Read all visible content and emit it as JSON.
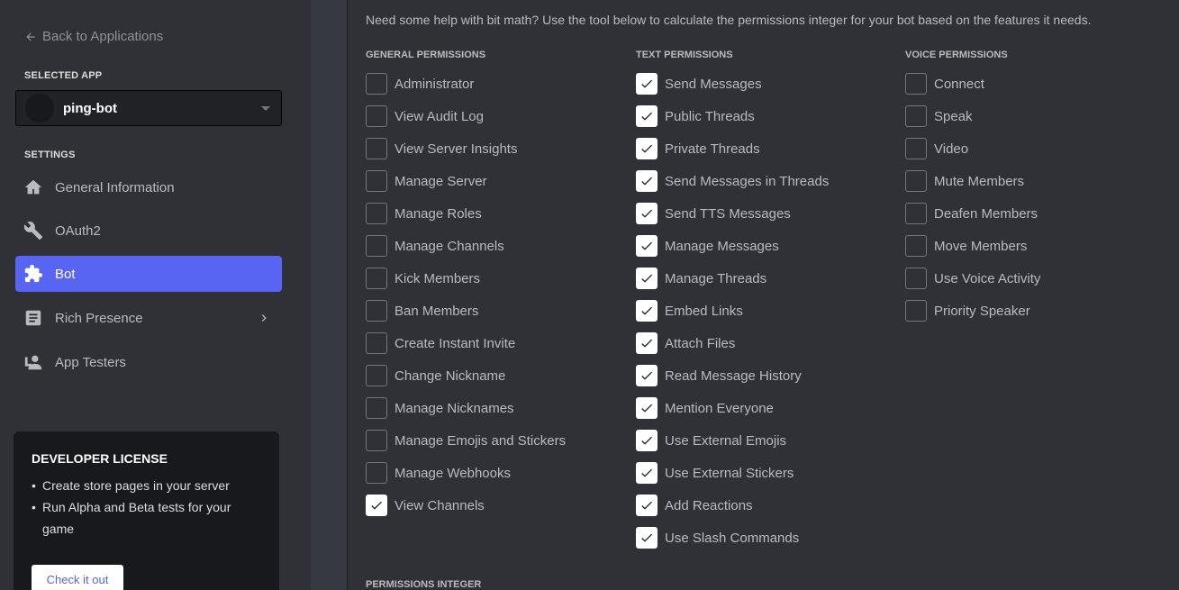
{
  "sidebar": {
    "back_label": "Back to Applications",
    "selected_app_label": "SELECTED APP",
    "app_name": "ping-bot",
    "settings_label": "SETTINGS",
    "nav": [
      {
        "label": "General Information",
        "icon": "home-icon"
      },
      {
        "label": "OAuth2",
        "icon": "wrench-icon"
      },
      {
        "label": "Bot",
        "icon": "puzzle-icon",
        "active": true
      },
      {
        "label": "Rich Presence",
        "icon": "document-icon",
        "has_chevron": true
      },
      {
        "label": "App Testers",
        "icon": "person-icon"
      }
    ],
    "license": {
      "title": "DEVELOPER LICENSE",
      "items": [
        "Create store pages in your server",
        "Run Alpha and Beta tests for your game"
      ],
      "button": "Check it out"
    }
  },
  "main": {
    "help_text": "Need some help with bit math? Use the tool below to calculate the permissions integer for your bot based on the features it needs.",
    "columns": [
      {
        "heading": "GENERAL PERMISSIONS",
        "items": [
          {
            "label": "Administrator",
            "checked": false
          },
          {
            "label": "View Audit Log",
            "checked": false
          },
          {
            "label": "View Server Insights",
            "checked": false
          },
          {
            "label": "Manage Server",
            "checked": false
          },
          {
            "label": "Manage Roles",
            "checked": false
          },
          {
            "label": "Manage Channels",
            "checked": false
          },
          {
            "label": "Kick Members",
            "checked": false
          },
          {
            "label": "Ban Members",
            "checked": false
          },
          {
            "label": "Create Instant Invite",
            "checked": false
          },
          {
            "label": "Change Nickname",
            "checked": false
          },
          {
            "label": "Manage Nicknames",
            "checked": false
          },
          {
            "label": "Manage Emojis and Stickers",
            "checked": false
          },
          {
            "label": "Manage Webhooks",
            "checked": false
          },
          {
            "label": "View Channels",
            "checked": true
          }
        ]
      },
      {
        "heading": "TEXT PERMISSIONS",
        "items": [
          {
            "label": "Send Messages",
            "checked": true
          },
          {
            "label": "Public Threads",
            "checked": true
          },
          {
            "label": "Private Threads",
            "checked": true
          },
          {
            "label": "Send Messages in Threads",
            "checked": true
          },
          {
            "label": "Send TTS Messages",
            "checked": true
          },
          {
            "label": "Manage Messages",
            "checked": true
          },
          {
            "label": "Manage Threads",
            "checked": true
          },
          {
            "label": "Embed Links",
            "checked": true
          },
          {
            "label": "Attach Files",
            "checked": true
          },
          {
            "label": "Read Message History",
            "checked": true
          },
          {
            "label": "Mention Everyone",
            "checked": true
          },
          {
            "label": "Use External Emojis",
            "checked": true
          },
          {
            "label": "Use External Stickers",
            "checked": true
          },
          {
            "label": "Add Reactions",
            "checked": true
          },
          {
            "label": "Use Slash Commands",
            "checked": true
          }
        ]
      },
      {
        "heading": "VOICE PERMISSIONS",
        "items": [
          {
            "label": "Connect",
            "checked": false
          },
          {
            "label": "Speak",
            "checked": false
          },
          {
            "label": "Video",
            "checked": false
          },
          {
            "label": "Mute Members",
            "checked": false
          },
          {
            "label": "Deafen Members",
            "checked": false
          },
          {
            "label": "Move Members",
            "checked": false
          },
          {
            "label": "Use Voice Activity",
            "checked": false
          },
          {
            "label": "Priority Speaker",
            "checked": false
          }
        ]
      }
    ],
    "permissions_integer_label": "PERMISSIONS INTEGER"
  }
}
